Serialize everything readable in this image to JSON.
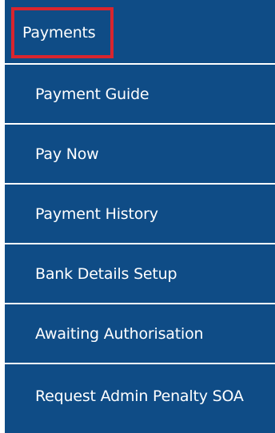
{
  "menu": {
    "header_label": "Payments",
    "items": [
      {
        "label": "Payment Guide"
      },
      {
        "label": "Pay Now"
      },
      {
        "label": "Payment History"
      },
      {
        "label": "Bank Details Setup"
      },
      {
        "label": "Awaiting Authorisation"
      },
      {
        "label": "Request Admin Penalty SOA"
      }
    ],
    "colors": {
      "background": "#0f4c86",
      "text": "#ffffff",
      "separator": "#ffffff",
      "highlight_border": "#d9252e"
    }
  }
}
